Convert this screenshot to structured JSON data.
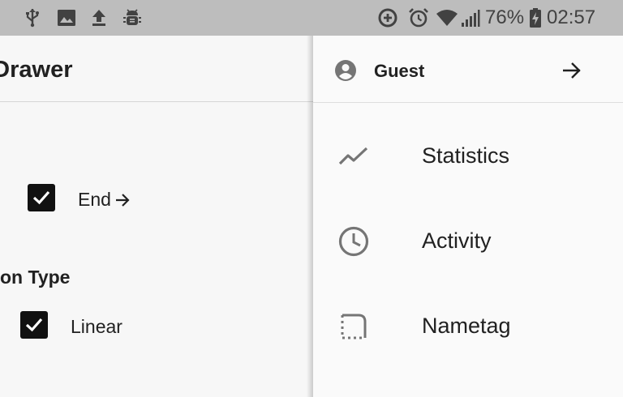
{
  "status_bar": {
    "battery_percent": "76%",
    "time": "02:57",
    "icons": [
      "usb-icon",
      "image-icon",
      "upload-icon",
      "android-debug-icon",
      "data-saver-icon",
      "alarm-icon",
      "wifi-icon",
      "signal-icon",
      "battery-charging-icon"
    ]
  },
  "page": {
    "title": "ner Drawer",
    "end_option": {
      "label": "End",
      "checked": true,
      "icon": "arrow-right-icon"
    },
    "section_title": "on Type",
    "linear_option": {
      "label": "Linear",
      "checked": true
    }
  },
  "drawer": {
    "header": {
      "user_label": "Guest",
      "avatar_icon": "account-circle-icon",
      "action_icon": "arrow-right-icon"
    },
    "items": [
      {
        "label": "Statistics",
        "icon": "trending-icon"
      },
      {
        "label": "Activity",
        "icon": "clock-icon"
      },
      {
        "label": "Nametag",
        "icon": "crop-free-icon"
      }
    ]
  },
  "colors": {
    "status_bar_bg": "#bdbdbd",
    "drawer_bg": "#fafafa",
    "icon_gray": "#757575",
    "checkbox": "#111111"
  }
}
